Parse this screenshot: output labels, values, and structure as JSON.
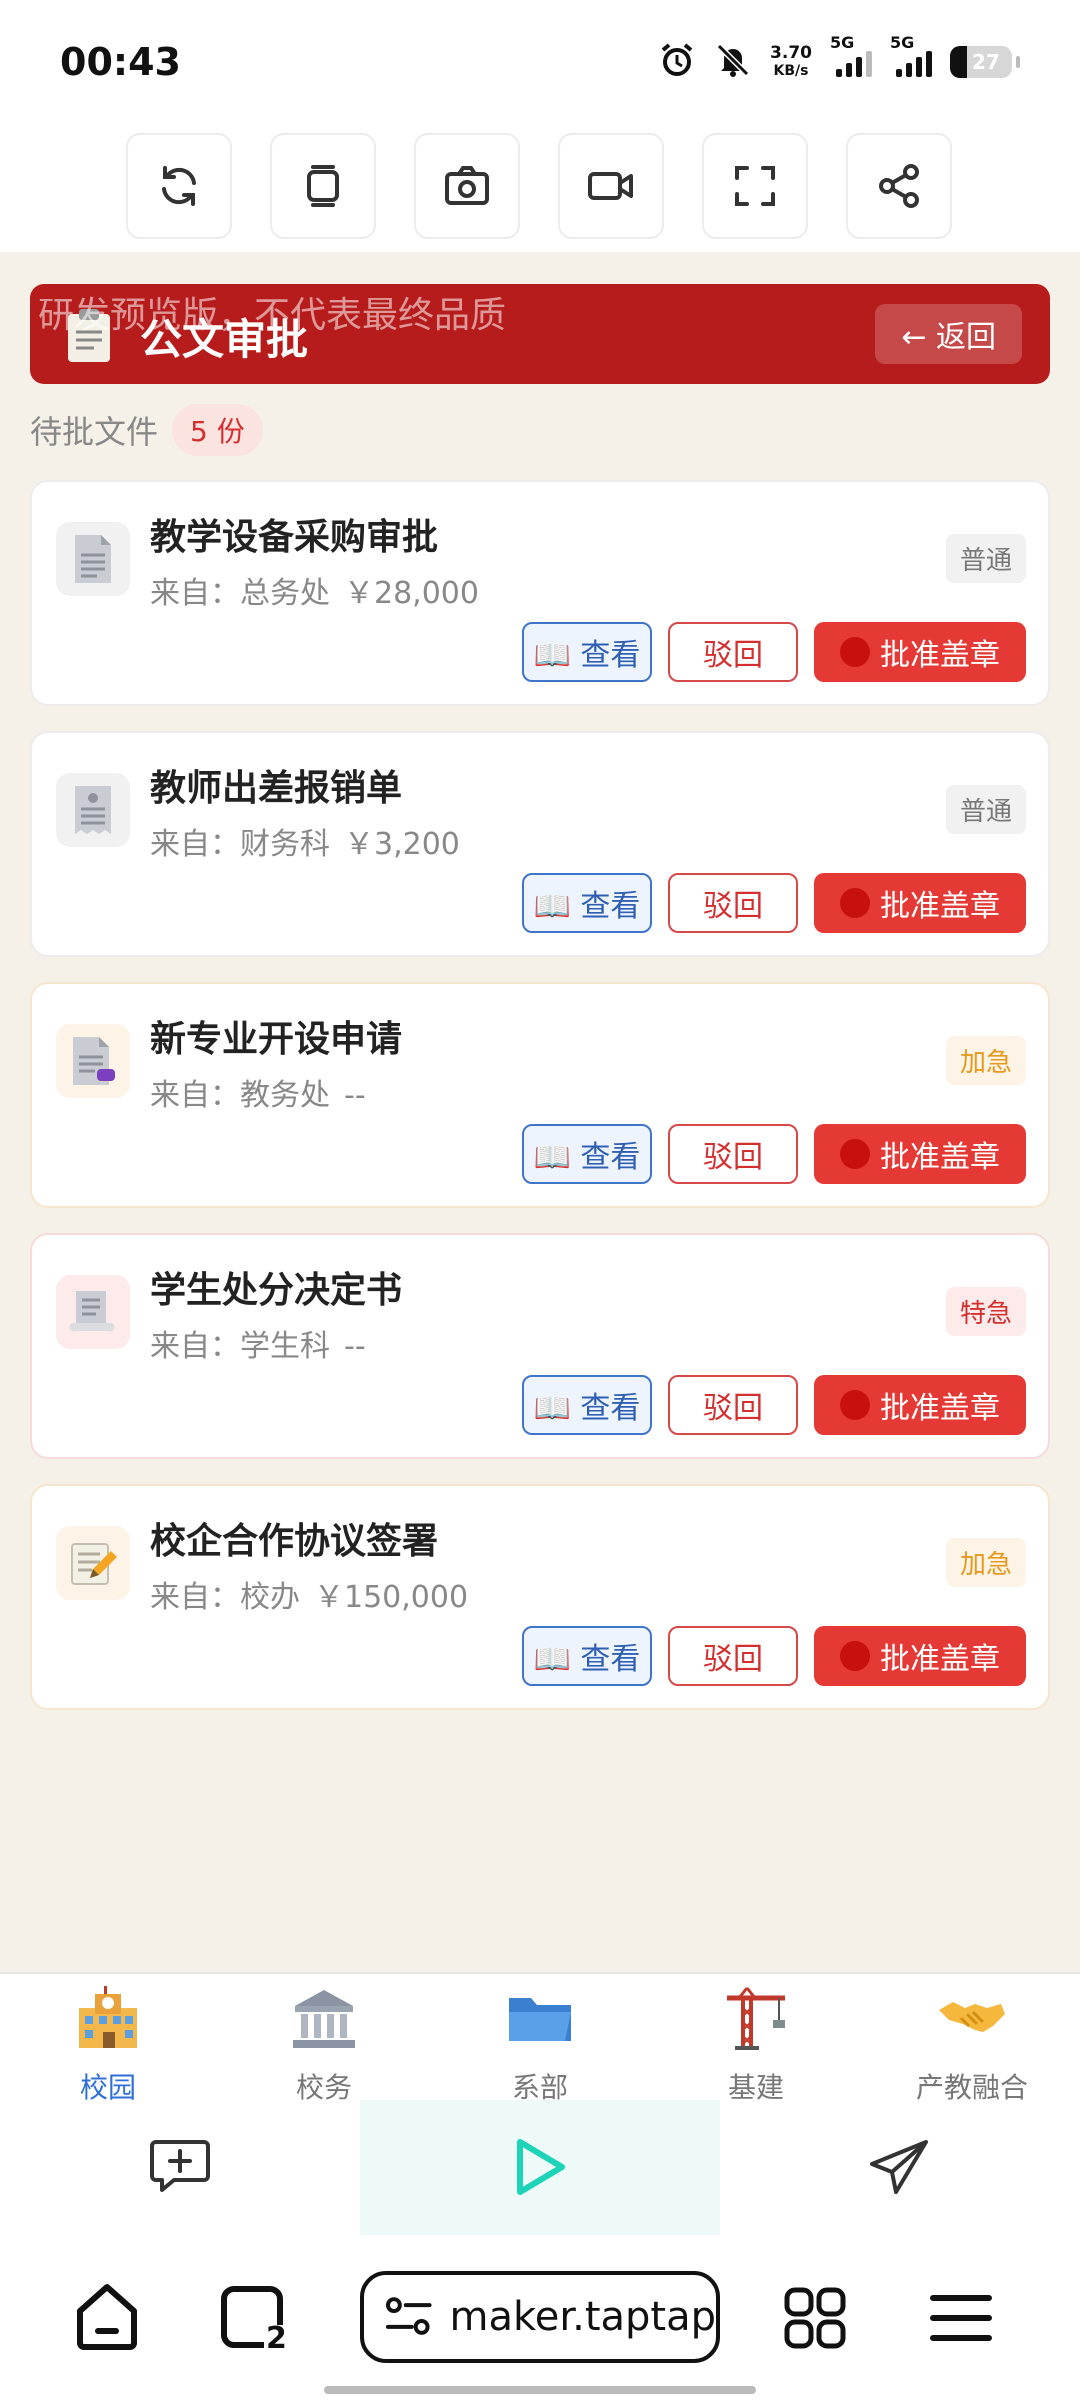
{
  "status_bar": {
    "time": "00:43",
    "net_speed_value": "3.70",
    "net_speed_unit": "KB/s",
    "sim1": "5G",
    "sim2": "5G",
    "battery": "27"
  },
  "toolbar": {
    "tools": [
      "refresh-icon",
      "copy-icon",
      "camera-icon",
      "video-icon",
      "fullscreen-icon",
      "share-icon"
    ]
  },
  "header": {
    "title": "公文审批",
    "watermark": "研发预览版，不代表最终品质",
    "back_label": "← 返回"
  },
  "pending": {
    "label": "待批文件",
    "count": "5 份"
  },
  "documents": [
    {
      "title": "教学设备采购审批",
      "from": "来自：总务处",
      "amount": "￥28,000",
      "badge": "普通",
      "priority": "normal",
      "icon": "document-icon"
    },
    {
      "title": "教师出差报销单",
      "from": "来自：财务科",
      "amount": "￥3,200",
      "badge": "普通",
      "priority": "normal",
      "icon": "receipt-icon"
    },
    {
      "title": "新专业开设申请",
      "from": "来自：教务处",
      "amount": "--",
      "badge": "加急",
      "priority": "urgent",
      "icon": "document-tag-icon"
    },
    {
      "title": "学生处分决定书",
      "from": "来自：学生科",
      "amount": "--",
      "badge": "特急",
      "priority": "special",
      "icon": "scroll-icon"
    },
    {
      "title": "校企合作协议签署",
      "from": "来自：校办",
      "amount": "￥150,000",
      "badge": "加急",
      "priority": "urgent",
      "icon": "memo-icon"
    }
  ],
  "actions": {
    "view": "📖 查看",
    "reject": "驳回",
    "approve": "批准盖章"
  },
  "bottom_nav": [
    {
      "label": "校园",
      "icon": "school-icon",
      "active": true
    },
    {
      "label": "校务",
      "icon": "classical-building-icon",
      "active": false
    },
    {
      "label": "系部",
      "icon": "folder-icon",
      "active": false
    },
    {
      "label": "基建",
      "icon": "crane-icon",
      "active": false
    },
    {
      "label": "产教融合",
      "icon": "handshake-icon",
      "active": false
    }
  ],
  "browser": {
    "url": "maker.taptap",
    "tab_count": "2"
  },
  "colors": {
    "header_red": "#b71c1c",
    "approve_red": "#e53935",
    "view_blue": "#3f75c9",
    "urgent_orange": "#e69a1b",
    "active_nav_blue": "#2f6fd6",
    "background": "#f5f0e8"
  }
}
